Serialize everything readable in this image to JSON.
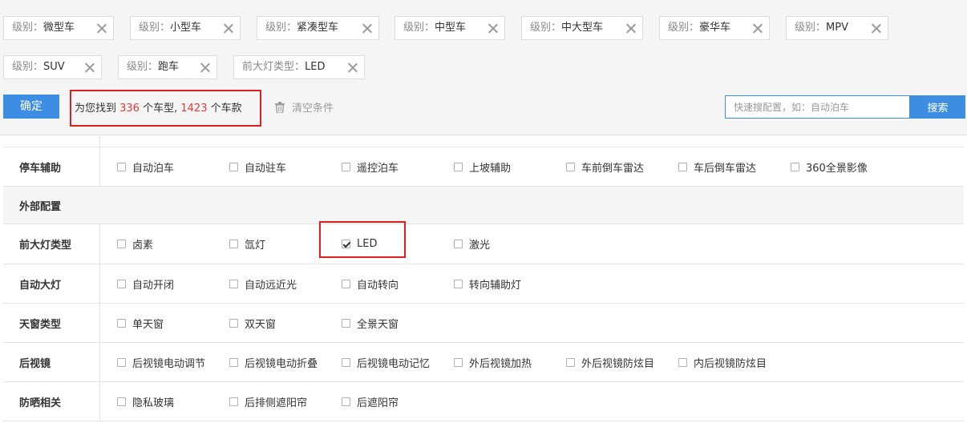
{
  "filter_tags": [
    {
      "key": "级别：",
      "value": "微型车"
    },
    {
      "key": "级别：",
      "value": "小型车"
    },
    {
      "key": "级别：",
      "value": "紧凑型车"
    },
    {
      "key": "级别：",
      "value": "中型车"
    },
    {
      "key": "级别：",
      "value": "中大型车"
    },
    {
      "key": "级别：",
      "value": "豪华车"
    },
    {
      "key": "级别：",
      "value": "MPV"
    },
    {
      "key": "级别：",
      "value": "SUV"
    },
    {
      "key": "级别：",
      "value": "跑车"
    },
    {
      "key": "前大灯类型：",
      "value": "LED"
    }
  ],
  "toolbar": {
    "confirm_label": "确定",
    "result_prefix": "为您找到 ",
    "model_count": "336",
    "result_mid": " 个车型, ",
    "trim_count": "1423",
    "result_suffix": " 个车款",
    "clear_label": "清空条件",
    "search_placeholder": "快速搜配置，如：自动泊车",
    "search_value": "",
    "search_label": "搜索"
  },
  "rows": [
    {
      "label": "停车辅助",
      "options": [
        {
          "label": "自动泊车",
          "checked": false
        },
        {
          "label": "自动驻车",
          "checked": false
        },
        {
          "label": "遥控泊车",
          "checked": false
        },
        {
          "label": "上坡辅助",
          "checked": false
        },
        {
          "label": "车前倒车雷达",
          "checked": false
        },
        {
          "label": "车后倒车雷达",
          "checked": false
        },
        {
          "label": "360全景影像",
          "checked": false
        }
      ]
    },
    {
      "label": "外部配置",
      "section": true
    },
    {
      "label": "前大灯类型",
      "options": [
        {
          "label": "卤素",
          "checked": false
        },
        {
          "label": "氙灯",
          "checked": false
        },
        {
          "label": "LED",
          "checked": true
        },
        {
          "label": "激光",
          "checked": false
        }
      ]
    },
    {
      "label": "自动大灯",
      "options": [
        {
          "label": "自动开闭",
          "checked": false
        },
        {
          "label": "自动远近光",
          "checked": false
        },
        {
          "label": "自动转向",
          "checked": false
        },
        {
          "label": "转向辅助灯",
          "checked": false
        }
      ]
    },
    {
      "label": "天窗类型",
      "options": [
        {
          "label": "单天窗",
          "checked": false
        },
        {
          "label": "双天窗",
          "checked": false
        },
        {
          "label": "全景天窗",
          "checked": false
        }
      ]
    },
    {
      "label": "后视镜",
      "options": [
        {
          "label": "后视镜电动调节",
          "checked": false
        },
        {
          "label": "后视镜电动折叠",
          "checked": false
        },
        {
          "label": "后视镜电动记忆",
          "checked": false
        },
        {
          "label": "外后视镜加热",
          "checked": false
        },
        {
          "label": "外后视镜防炫目",
          "checked": false
        },
        {
          "label": "内后视镜防炫目",
          "checked": false
        }
      ]
    },
    {
      "label": "防晒相关",
      "options": [
        {
          "label": "隐私玻璃",
          "checked": false
        },
        {
          "label": "后排侧遮阳帘",
          "checked": false
        },
        {
          "label": "后遮阳帘",
          "checked": false
        }
      ]
    }
  ],
  "colors": {
    "accent": "#3d8ee3",
    "highlight": "#e02020",
    "count": "#e33333"
  }
}
